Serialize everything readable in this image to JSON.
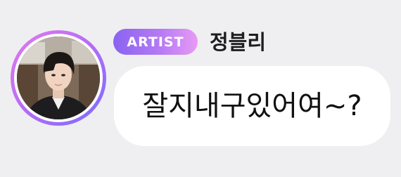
{
  "sender": {
    "badge_label": "ARTIST",
    "name": "정블리",
    "avatar": "profile-photo"
  },
  "message": {
    "text": "잘지내구있어여~?"
  },
  "colors": {
    "background": "#efeff1",
    "bubble": "#ffffff",
    "badge_gradient_start": "#8a63f2",
    "badge_gradient_end": "#e89af4",
    "avatar_ring_start": "#e07bf0",
    "avatar_ring_end": "#7a6cff",
    "text": "#111111"
  }
}
